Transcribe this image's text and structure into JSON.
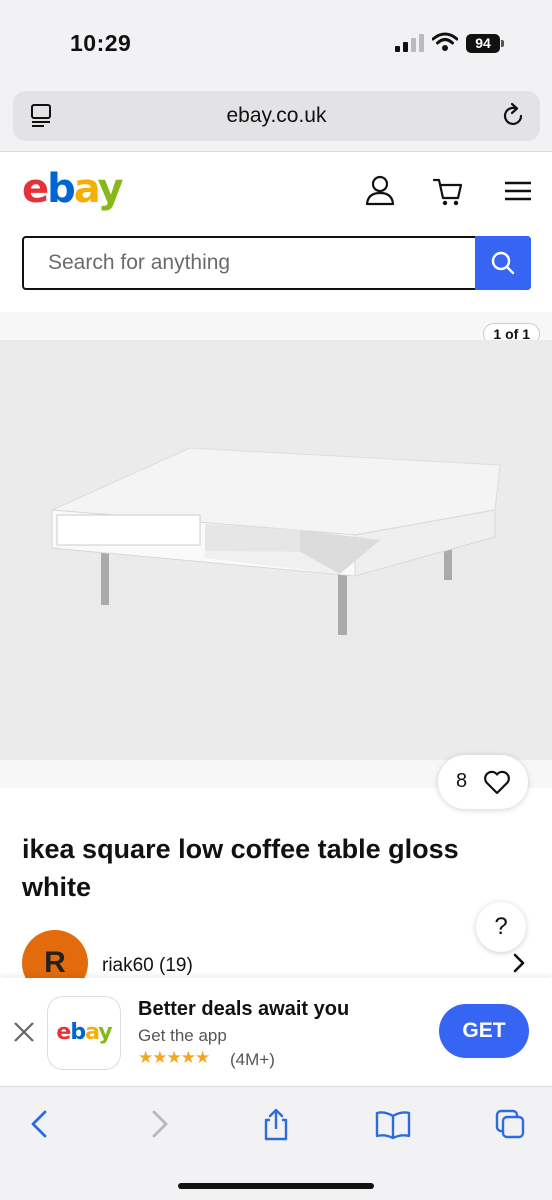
{
  "status_bar": {
    "time": "10:29",
    "battery": "94"
  },
  "browser": {
    "url": "ebay.co.uk"
  },
  "header": {
    "logo": {
      "e": "e",
      "b": "b",
      "a": "a",
      "y": "y"
    },
    "search": {
      "placeholder": "Search for anything"
    }
  },
  "gallery": {
    "counter": "1 of 1"
  },
  "listing": {
    "watch_count": "8",
    "title": "ikea square low coffee table gloss white",
    "help": "?",
    "seller": {
      "initial": "R",
      "name": "riak60 (19)"
    }
  },
  "app_banner": {
    "logo": "ebay",
    "title": "Better deals await you",
    "subtitle": "Get the app",
    "stars": "★★★★★",
    "rating_count": "(4M+)",
    "button": "GET"
  },
  "colors": {
    "accent": "#3665f3",
    "avatar": "#e36b0c"
  }
}
